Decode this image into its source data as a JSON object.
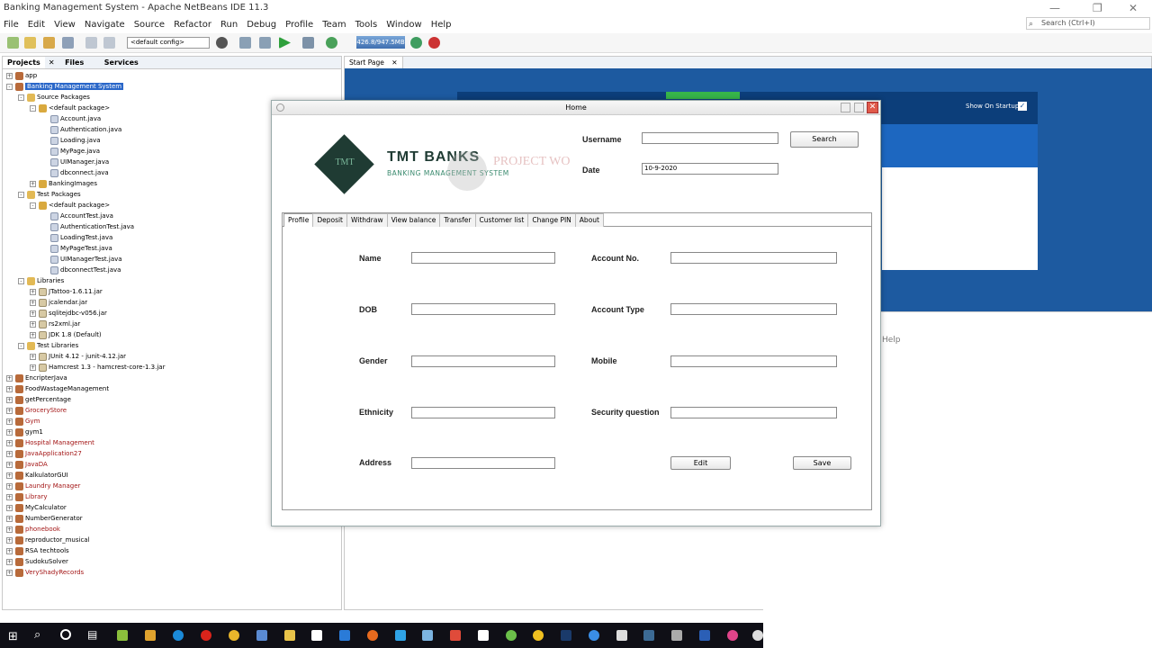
{
  "window": {
    "title": "Banking Management System - Apache NetBeans IDE 11.3"
  },
  "menu": [
    "File",
    "Edit",
    "View",
    "Navigate",
    "Source",
    "Refactor",
    "Run",
    "Debug",
    "Profile",
    "Team",
    "Tools",
    "Window",
    "Help"
  ],
  "search": {
    "placeholder": "Search (Ctrl+I)"
  },
  "toolbar": {
    "config": "<default config>",
    "memory": "426.8/947.5MB"
  },
  "projects_panel": {
    "tabs": [
      "Projects",
      "Files",
      "Services"
    ],
    "tree": [
      {
        "label": "app",
        "kind": "cup",
        "indent": 0,
        "tog": "+"
      },
      {
        "label": "Banking Management System",
        "kind": "cup",
        "indent": 0,
        "tog": "-",
        "selected": true
      },
      {
        "label": "Source Packages",
        "kind": "fold",
        "indent": 1,
        "tog": "-"
      },
      {
        "label": "<default package>",
        "kind": "pkg",
        "indent": 2,
        "tog": "-"
      },
      {
        "label": "Account.java",
        "kind": "file",
        "indent": 3
      },
      {
        "label": "Authentication.java",
        "kind": "file",
        "indent": 3
      },
      {
        "label": "Loading.java",
        "kind": "file",
        "indent": 3
      },
      {
        "label": "MyPage.java",
        "kind": "file",
        "indent": 3
      },
      {
        "label": "UIManager.java",
        "kind": "file",
        "indent": 3
      },
      {
        "label": "dbconnect.java",
        "kind": "file",
        "indent": 3
      },
      {
        "label": "BankingImages",
        "kind": "pkg",
        "indent": 2,
        "tog": "+"
      },
      {
        "label": "Test Packages",
        "kind": "fold",
        "indent": 1,
        "tog": "-"
      },
      {
        "label": "<default package>",
        "kind": "pkg",
        "indent": 2,
        "tog": "-"
      },
      {
        "label": "AccountTest.java",
        "kind": "file",
        "indent": 3
      },
      {
        "label": "AuthenticationTest.java",
        "kind": "file",
        "indent": 3
      },
      {
        "label": "LoadingTest.java",
        "kind": "file",
        "indent": 3
      },
      {
        "label": "MyPageTest.java",
        "kind": "file",
        "indent": 3
      },
      {
        "label": "UIManagerTest.java",
        "kind": "file",
        "indent": 3
      },
      {
        "label": "dbconnectTest.java",
        "kind": "file",
        "indent": 3
      },
      {
        "label": "Libraries",
        "kind": "fold",
        "indent": 1,
        "tog": "-"
      },
      {
        "label": "JTattoo-1.6.11.jar",
        "kind": "jar",
        "indent": 2,
        "tog": "+"
      },
      {
        "label": "jcalendar.jar",
        "kind": "jar",
        "indent": 2,
        "tog": "+"
      },
      {
        "label": "sqlitejdbc-v056.jar",
        "kind": "jar",
        "indent": 2,
        "tog": "+"
      },
      {
        "label": "rs2xml.jar",
        "kind": "jar",
        "indent": 2,
        "tog": "+"
      },
      {
        "label": "JDK 1.8 (Default)",
        "kind": "jar",
        "indent": 2,
        "tog": "+"
      },
      {
        "label": "Test Libraries",
        "kind": "fold",
        "indent": 1,
        "tog": "-"
      },
      {
        "label": "JUnit 4.12 - junit-4.12.jar",
        "kind": "jar",
        "indent": 2,
        "tog": "+"
      },
      {
        "label": "Hamcrest 1.3 - hamcrest-core-1.3.jar",
        "kind": "jar",
        "indent": 2,
        "tog": "+"
      },
      {
        "label": "EncripterJava",
        "kind": "cup",
        "indent": 0,
        "tog": "+"
      },
      {
        "label": "FoodWastageManagement",
        "kind": "cup",
        "indent": 0,
        "tog": "+"
      },
      {
        "label": "getPercentage",
        "kind": "cup",
        "indent": 0,
        "tog": "+"
      },
      {
        "label": "GroceryStore",
        "kind": "cup",
        "indent": 0,
        "tog": "+",
        "red": true
      },
      {
        "label": "Gym",
        "kind": "cup",
        "indent": 0,
        "tog": "+",
        "red": true
      },
      {
        "label": "gym1",
        "kind": "cup",
        "indent": 0,
        "tog": "+"
      },
      {
        "label": "Hospital Management",
        "kind": "cup",
        "indent": 0,
        "tog": "+",
        "red": true
      },
      {
        "label": "JavaApplication27",
        "kind": "cup",
        "indent": 0,
        "tog": "+",
        "red": true
      },
      {
        "label": "JavaDA",
        "kind": "cup",
        "indent": 0,
        "tog": "+",
        "red": true
      },
      {
        "label": "KalkulatorGUI",
        "kind": "cup",
        "indent": 0,
        "tog": "+"
      },
      {
        "label": "Laundry Manager",
        "kind": "cup",
        "indent": 0,
        "tog": "+",
        "red": true
      },
      {
        "label": "Library",
        "kind": "cup",
        "indent": 0,
        "tog": "+",
        "red": true
      },
      {
        "label": "MyCalculator",
        "kind": "cup",
        "indent": 0,
        "tog": "+"
      },
      {
        "label": "NumberGenerator",
        "kind": "cup",
        "indent": 0,
        "tog": "+"
      },
      {
        "label": "phonebook",
        "kind": "cup",
        "indent": 0,
        "tog": "+",
        "red": true
      },
      {
        "label": "reproductor_musical",
        "kind": "cup",
        "indent": 0,
        "tog": "+"
      },
      {
        "label": "RSA techtools",
        "kind": "cup",
        "indent": 0,
        "tog": "+"
      },
      {
        "label": "SudokuSolver",
        "kind": "cup",
        "indent": 0,
        "tog": "+"
      },
      {
        "label": "VeryShadyRecords",
        "kind": "cup",
        "indent": 0,
        "tog": "+",
        "red": true
      }
    ]
  },
  "editor": {
    "tab": "Start Page",
    "show_on_startup": "Show On Startup",
    "help": "Help"
  },
  "dialog": {
    "title": "Home",
    "brand_name": "TMT BANKS",
    "brand_tagline": "BANKING MANAGEMENT SYSTEM",
    "brand_monogram": "TMT",
    "watermark": "PROJECT WO",
    "username_label": "Username",
    "username_value": "",
    "search_button": "Search",
    "date_label": "Date",
    "date_value": "10-9-2020",
    "tabs": [
      "Profile",
      "Deposit",
      "Withdraw",
      "View balance",
      "Transfer",
      "Customer list",
      "Change PIN",
      "About"
    ],
    "fields": {
      "name": "Name",
      "dob": "DOB",
      "gender": "Gender",
      "ethnicity": "Ethnicity",
      "address": "Address",
      "account_no": "Account No.",
      "account_type": "Account Type",
      "mobile": "Mobile",
      "security_question": "Security question"
    },
    "edit_button": "Edit",
    "save_button": "Save"
  },
  "colors": {
    "accent": "#1d5aa0",
    "logo": "#1f3b33",
    "tagline": "#3a8a6e"
  }
}
